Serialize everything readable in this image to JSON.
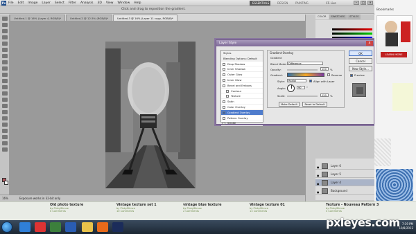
{
  "app": {
    "logo": "Ps",
    "menu": [
      "File",
      "Edit",
      "Image",
      "Layer",
      "Select",
      "Filter",
      "Analysis",
      "3D",
      "View",
      "Window",
      "Help"
    ],
    "workspaces": [
      "ESSENTIALS",
      "DESIGN",
      "PAINTING"
    ],
    "cs_live": "CS Live",
    "options_hint": "Click and drag to reposition the gradient."
  },
  "doc_tabs": [
    "Untitled-1 @ 16% (Layer 4, RGB/8)*",
    "Untitled-2 @ 12.5% (RGB/8)*",
    "Untitled-3 @ 16% (Layer 11 copy, RGB/8)*"
  ],
  "status": {
    "zoom": "16%",
    "info": "Exposure works in 32-bit only"
  },
  "panels": {
    "color_tabs": [
      "COLOR",
      "SWATCHES",
      "STYLES"
    ],
    "layers": [
      {
        "name": "Layer 6",
        "selected": false
      },
      {
        "name": "Layer 5",
        "selected": false
      },
      {
        "name": "Layer 4",
        "selected": true
      },
      {
        "name": "Background",
        "selected": false
      }
    ]
  },
  "dialog": {
    "title": "Layer Style",
    "close": "x",
    "styles": [
      {
        "label": "Styles",
        "header": true,
        "checked": false,
        "selected": false,
        "indent": false
      },
      {
        "label": "Blending Options: Default",
        "header": true,
        "checked": false,
        "selected": false,
        "indent": false
      },
      {
        "label": "Drop Shadow",
        "header": false,
        "checked": false,
        "selected": false,
        "indent": false
      },
      {
        "label": "Inner Shadow",
        "header": false,
        "checked": false,
        "selected": false,
        "indent": false
      },
      {
        "label": "Outer Glow",
        "header": false,
        "checked": false,
        "selected": false,
        "indent": false
      },
      {
        "label": "Inner Glow",
        "header": false,
        "checked": false,
        "selected": false,
        "indent": false
      },
      {
        "label": "Bevel and Emboss",
        "header": false,
        "checked": false,
        "selected": false,
        "indent": false
      },
      {
        "label": "Contour",
        "header": false,
        "checked": false,
        "selected": false,
        "indent": true
      },
      {
        "label": "Texture",
        "header": false,
        "checked": false,
        "selected": false,
        "indent": true
      },
      {
        "label": "Satin",
        "header": false,
        "checked": false,
        "selected": false,
        "indent": false
      },
      {
        "label": "Color Overlay",
        "header": false,
        "checked": false,
        "selected": false,
        "indent": false
      },
      {
        "label": "Gradient Overlay",
        "header": false,
        "checked": true,
        "selected": true,
        "indent": false
      },
      {
        "label": "Pattern Overlay",
        "header": false,
        "checked": false,
        "selected": false,
        "indent": false
      },
      {
        "label": "Stroke",
        "header": false,
        "checked": false,
        "selected": false,
        "indent": false
      }
    ],
    "group_title": "Gradient Overlay",
    "sub_title": "Gradient",
    "blend_mode_label": "Blend Mode:",
    "blend_mode_value": "Difference",
    "opacity_label": "Opacity:",
    "opacity_value": "100",
    "opacity_unit": "%",
    "gradient_label": "Gradient:",
    "reverse_label": "Reverse",
    "style_label": "Style:",
    "style_value": "Radial",
    "align_label": "Align with Layer",
    "angle_label": "Angle:",
    "angle_value": "90",
    "angle_unit": "°",
    "scale_label": "Scale:",
    "scale_value": "150",
    "scale_unit": "%",
    "make_default": "Make Default",
    "reset_default": "Reset to Default",
    "buttons": {
      "ok": "OK",
      "cancel": "Cancel",
      "new_style": "New Style...",
      "preview": "Preview"
    }
  },
  "browser": {
    "bookmarks": "Bookmarks",
    "ad_button": "LEARN MORE"
  },
  "site_items": [
    {
      "title": "Old photo texture",
      "by": "by PinkySlimce",
      "comments": "0 Comments"
    },
    {
      "title": "Vintage texture set 1",
      "by": "by PinkySlimce",
      "comments": "10 Comments"
    },
    {
      "title": "vintage blue texture",
      "by": "by PinkySlimce",
      "comments": "2 Comments"
    },
    {
      "title": "Vintage texture 01",
      "by": "by PinkySlimce",
      "comments": "13 Comments"
    },
    {
      "title": "Texture - Nouveau Pattern 3",
      "by": "by PinkySlimce",
      "comments": "3 Comments"
    }
  ],
  "taskbar": {
    "time": "7:19 PM",
    "date": "10/8/2012"
  },
  "watermark": "pxleyes.com"
}
